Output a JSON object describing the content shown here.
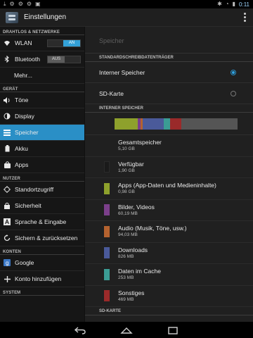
{
  "status": {
    "time": "0:11",
    "left_icons": [
      "download-icon",
      "settings-icon",
      "settings-icon",
      "settings-icon",
      "photo-icon"
    ],
    "right_icons": [
      "bluetooth-icon",
      "wifi-icon",
      "battery-icon"
    ]
  },
  "actionbar": {
    "title": "Einstellungen"
  },
  "sidebar": {
    "sections": [
      {
        "header": "DRAHTLOS & NETZWERKE",
        "items": [
          {
            "label": "WLAN",
            "icon": "wifi-icon",
            "toggle": "AN"
          },
          {
            "label": "Bluetooth",
            "icon": "bluetooth-icon",
            "toggle": "AUS"
          },
          {
            "label": "Mehr..."
          }
        ]
      },
      {
        "header": "GERÄT",
        "items": [
          {
            "label": "Töne",
            "icon": "volume-icon"
          },
          {
            "label": "Display",
            "icon": "display-icon"
          },
          {
            "label": "Speicher",
            "icon": "storage-icon",
            "selected": true
          },
          {
            "label": "Akku",
            "icon": "battery-icon"
          },
          {
            "label": "Apps",
            "icon": "apps-icon"
          }
        ]
      },
      {
        "header": "NUTZER",
        "items": [
          {
            "label": "Standortzugriff",
            "icon": "location-icon"
          },
          {
            "label": "Sicherheit",
            "icon": "lock-icon"
          },
          {
            "label": "Sprache & Eingabe",
            "icon": "language-icon"
          },
          {
            "label": "Sichern & zurücksetzen",
            "icon": "backup-icon"
          }
        ]
      },
      {
        "header": "KONTEN",
        "items": [
          {
            "label": "Google",
            "icon": "google-icon"
          },
          {
            "label": "Konto hinzufügen",
            "icon": "plus-icon"
          }
        ]
      },
      {
        "header": "SYSTEM",
        "items": []
      }
    ]
  },
  "main": {
    "title": "Speicher",
    "default_section": "STANDARDSCHREIBDATENTRÄGER",
    "options": [
      {
        "label": "Interner Speicher",
        "checked": true
      },
      {
        "label": "SD-Karte",
        "checked": false
      }
    ],
    "internal_section": "INTERNER SPEICHER",
    "usage_bar": [
      {
        "label": "Verfügbar",
        "color": "#1e1e1e",
        "fraction": 0.0
      },
      {
        "label": "Apps",
        "color": "#8ea12c",
        "fraction": 0.19
      },
      {
        "label": "Bilder, Videos",
        "color": "#7b3f8a",
        "fraction": 0.02
      },
      {
        "label": "Audio",
        "color": "#b4622f",
        "fraction": 0.02
      },
      {
        "label": "Downloads",
        "color": "#4a5a9a",
        "fraction": 0.17
      },
      {
        "label": "Daten im Cache",
        "color": "#3b9c94",
        "fraction": 0.05
      },
      {
        "label": "Sonstiges",
        "color": "#9a2a2a",
        "fraction": 0.09
      },
      {
        "label": "free",
        "color": "#555555",
        "fraction": 0.46
      }
    ],
    "rows": [
      {
        "name": "Gesamtspeicher",
        "value": "5,10 GB",
        "color": null
      },
      {
        "name": "Verfügbar",
        "value": "1,90 GB",
        "color": "#1a1a1a"
      },
      {
        "name": "Apps (App-Daten und Medieninhalte)",
        "value": "0,98 GB",
        "color": "#8ea12c"
      },
      {
        "name": "Bilder, Videos",
        "value": "60,19 MB",
        "color": "#7b3f8a"
      },
      {
        "name": "Audio (Musik, Töne, usw.)",
        "value": "94,03 MB",
        "color": "#b4622f"
      },
      {
        "name": "Downloads",
        "value": "826 MB",
        "color": "#4a5a9a"
      },
      {
        "name": "Daten im Cache",
        "value": "253 MB",
        "color": "#3b9c94"
      },
      {
        "name": "Sonstiges",
        "value": "469 MB",
        "color": "#9a2a2a"
      }
    ],
    "sd_section": "SD-KARTE"
  }
}
